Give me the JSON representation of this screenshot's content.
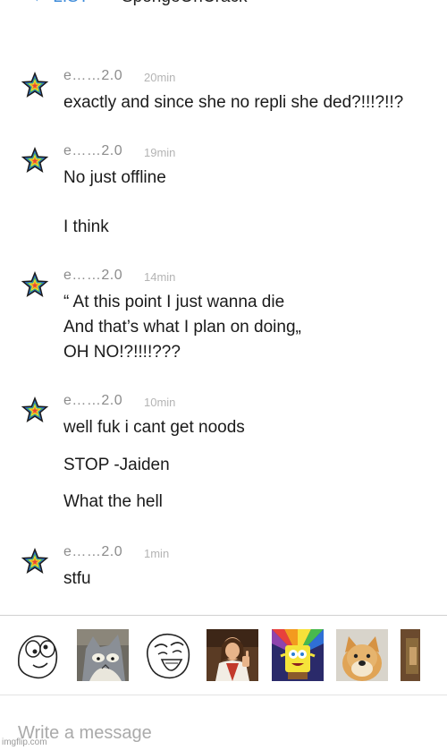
{
  "header": {
    "back_label": "← LIST",
    "title": "SpongeOnCrack"
  },
  "messages": [
    {
      "author": "e……2.0",
      "time": "20min",
      "lines": [
        "exactly and since she no repli she ded?!!!?!!?"
      ]
    },
    {
      "author": "e……2.0",
      "time": "19min",
      "lines": [
        "No just offline",
        "I think"
      ]
    },
    {
      "author": "e……2.0",
      "time": "14min",
      "lines": [
        "“ At this point I just wanna die",
        "And that’s what I plan on doing„",
        "OH NO!?!!!!???"
      ]
    },
    {
      "author": "e……2.0",
      "time": "10min",
      "lines": [
        "well fuk i cant get noods",
        "STOP -Jaiden",
        "What the hell"
      ]
    },
    {
      "author": "e……2.0",
      "time": "1min",
      "lines": [
        "stfu"
      ]
    }
  ],
  "avatar_icon": "rainbow-star-icon",
  "avatar_colors": [
    "#e8413c",
    "#f39a1f",
    "#f7e13a",
    "#48b94d",
    "#2f6fd6",
    "#1c1c1c"
  ],
  "stickers": [
    {
      "icon": "derp-face-sticker"
    },
    {
      "icon": "tom-cat-meme-sticker"
    },
    {
      "icon": "lol-face-sticker"
    },
    {
      "icon": "buddy-christ-sticker"
    },
    {
      "icon": "imagination-spongebob-sticker"
    },
    {
      "icon": "doge-sticker"
    },
    {
      "icon": "cropped-sticker"
    }
  ],
  "composer": {
    "placeholder": "Write a message"
  },
  "watermark": "imgflip.com"
}
